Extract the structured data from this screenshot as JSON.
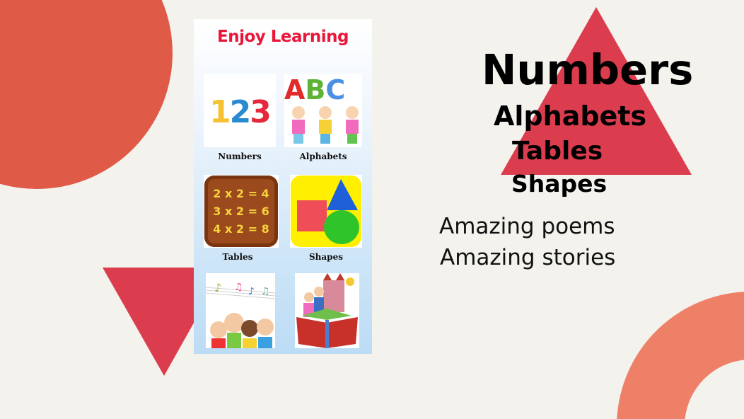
{
  "colors": {
    "background": "#f3f2ed",
    "circle": "#e05a48",
    "triangle": "#dc3d4e",
    "ring": "#ee8068",
    "app_title": "#e8173a"
  },
  "app": {
    "title": "Enjoy Learning",
    "tiles": [
      {
        "label": "Numbers",
        "image": "numbers-123-image",
        "text": "123"
      },
      {
        "label": "Alphabets",
        "image": "alphabets-abc-kids-image",
        "text": "ABC"
      },
      {
        "label": "Tables",
        "image": "multiplication-tables-board-image",
        "lines": [
          "2 x 2 = 4",
          "3 x 2 = 6",
          "4 x 2 = 8"
        ]
      },
      {
        "label": "Shapes",
        "image": "3d-shapes-image"
      },
      {
        "image": "singing-kids-poems-image"
      },
      {
        "image": "storybook-fairy-tale-image"
      }
    ]
  },
  "features": {
    "headings": [
      "Numbers",
      "Alphabets",
      "Tables",
      "Shapes"
    ],
    "extras": [
      "Amazing poems",
      "Amazing stories"
    ]
  }
}
